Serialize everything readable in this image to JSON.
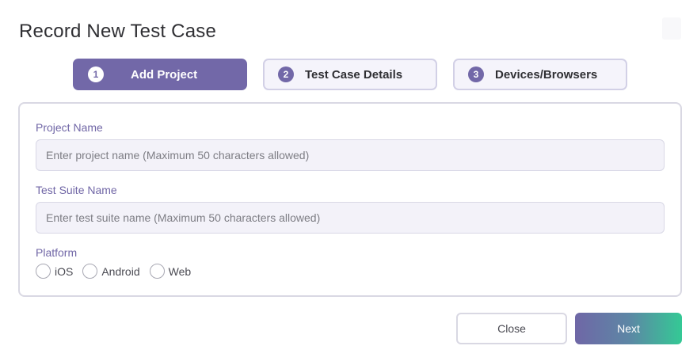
{
  "dialog": {
    "title": "Record New Test Case"
  },
  "stepper": {
    "steps": [
      {
        "number": "1",
        "label": "Add Project",
        "active": true
      },
      {
        "number": "2",
        "label": "Test Case Details",
        "active": false
      },
      {
        "number": "3",
        "label": "Devices/Browsers",
        "active": false
      }
    ]
  },
  "form": {
    "project_name": {
      "label": "Project Name",
      "value": "",
      "placeholder": "Enter project name (Maximum 50 characters allowed)"
    },
    "test_suite_name": {
      "label": "Test Suite Name",
      "value": "",
      "placeholder": "Enter test suite name (Maximum 50 characters allowed)"
    },
    "platform": {
      "label": "Platform",
      "options": [
        "iOS",
        "Android",
        "Web"
      ],
      "selected": null
    }
  },
  "footer": {
    "close_label": "Close",
    "next_label": "Next"
  },
  "colors": {
    "accent": "#7268a8",
    "next_gradient_start": "#6f67a6",
    "next_gradient_end": "#34c995",
    "border": "#d9d8e3"
  }
}
